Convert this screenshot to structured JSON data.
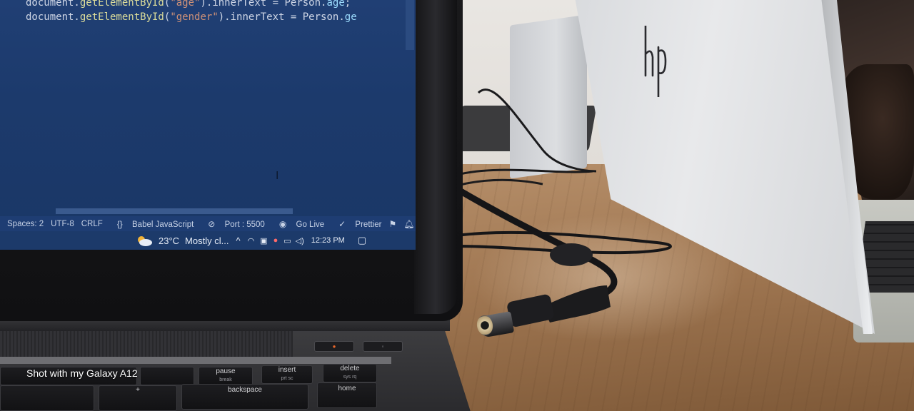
{
  "editor": {
    "code_line_1": {
      "a": "document.",
      "fn": "getElementById",
      "b": "(",
      "str": "\"age\"",
      "c": ").innerText = Person.",
      "prop": "age",
      "d": ";"
    },
    "code_line_2": {
      "a": "document.",
      "fn": "getElementById",
      "b": "(",
      "str": "\"gender\"",
      "c": ").innerText = Person.",
      "prop": "ge",
      "d": ""
    }
  },
  "statusbar": {
    "spaces": "Spaces: 2",
    "encoding": "UTF-8",
    "eol": "CRLF",
    "language": "Babel JavaScript",
    "port": "Port : 5500",
    "golive": "Go Live",
    "prettier": "Prettier"
  },
  "taskbar": {
    "temperature": "23°C",
    "weather": "Mostly cl...",
    "time": "12:23 PM"
  },
  "keyboard": {
    "keys": [
      {
        "label": "pause",
        "sub": "break"
      },
      {
        "label": "insert",
        "sub": "prt sc"
      },
      {
        "label": "delete",
        "sub": "sys rq"
      },
      {
        "label": "backspace",
        "sub": ""
      },
      {
        "label": "home",
        "sub": ""
      }
    ]
  },
  "photo": {
    "watermark": "Shot with my Galaxy A12"
  },
  "colors": {
    "editor_bg": "#1c3a6c",
    "statusbar_bg": "#1e3d73",
    "desk": "#9f7651"
  },
  "icons": {
    "weather": "partly-cloudy-icon",
    "tray_chevron": "chevron-up-icon",
    "network": "wifi-icon",
    "volume": "speaker-icon",
    "battery": "battery-icon",
    "notifications": "notification-icon"
  }
}
